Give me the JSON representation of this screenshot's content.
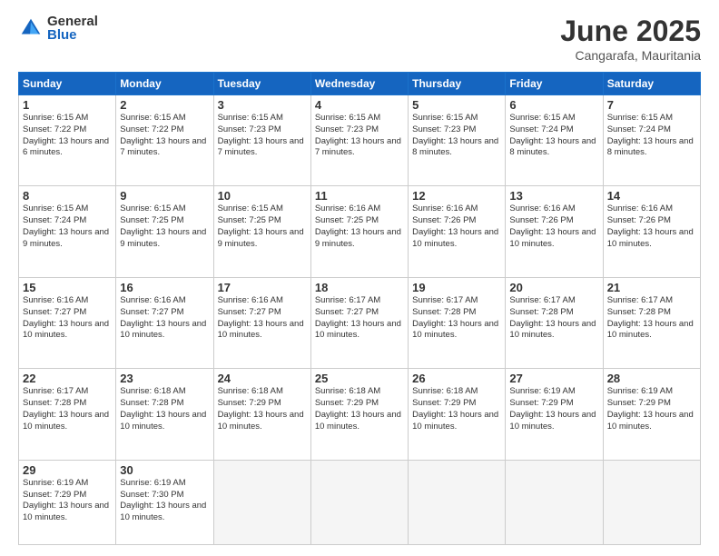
{
  "logo": {
    "general": "General",
    "blue": "Blue"
  },
  "title": "June 2025",
  "location": "Cangarafa, Mauritania",
  "weekdays": [
    "Sunday",
    "Monday",
    "Tuesday",
    "Wednesday",
    "Thursday",
    "Friday",
    "Saturday"
  ],
  "weeks": [
    [
      {
        "day": "1",
        "sunrise": "6:15 AM",
        "sunset": "7:22 PM",
        "daylight": "13 hours and 6 minutes."
      },
      {
        "day": "2",
        "sunrise": "6:15 AM",
        "sunset": "7:22 PM",
        "daylight": "13 hours and 7 minutes."
      },
      {
        "day": "3",
        "sunrise": "6:15 AM",
        "sunset": "7:23 PM",
        "daylight": "13 hours and 7 minutes."
      },
      {
        "day": "4",
        "sunrise": "6:15 AM",
        "sunset": "7:23 PM",
        "daylight": "13 hours and 7 minutes."
      },
      {
        "day": "5",
        "sunrise": "6:15 AM",
        "sunset": "7:23 PM",
        "daylight": "13 hours and 8 minutes."
      },
      {
        "day": "6",
        "sunrise": "6:15 AM",
        "sunset": "7:24 PM",
        "daylight": "13 hours and 8 minutes."
      },
      {
        "day": "7",
        "sunrise": "6:15 AM",
        "sunset": "7:24 PM",
        "daylight": "13 hours and 8 minutes."
      }
    ],
    [
      {
        "day": "8",
        "sunrise": "6:15 AM",
        "sunset": "7:24 PM",
        "daylight": "13 hours and 9 minutes."
      },
      {
        "day": "9",
        "sunrise": "6:15 AM",
        "sunset": "7:25 PM",
        "daylight": "13 hours and 9 minutes."
      },
      {
        "day": "10",
        "sunrise": "6:15 AM",
        "sunset": "7:25 PM",
        "daylight": "13 hours and 9 minutes."
      },
      {
        "day": "11",
        "sunrise": "6:16 AM",
        "sunset": "7:25 PM",
        "daylight": "13 hours and 9 minutes."
      },
      {
        "day": "12",
        "sunrise": "6:16 AM",
        "sunset": "7:26 PM",
        "daylight": "13 hours and 10 minutes."
      },
      {
        "day": "13",
        "sunrise": "6:16 AM",
        "sunset": "7:26 PM",
        "daylight": "13 hours and 10 minutes."
      },
      {
        "day": "14",
        "sunrise": "6:16 AM",
        "sunset": "7:26 PM",
        "daylight": "13 hours and 10 minutes."
      }
    ],
    [
      {
        "day": "15",
        "sunrise": "6:16 AM",
        "sunset": "7:27 PM",
        "daylight": "13 hours and 10 minutes."
      },
      {
        "day": "16",
        "sunrise": "6:16 AM",
        "sunset": "7:27 PM",
        "daylight": "13 hours and 10 minutes."
      },
      {
        "day": "17",
        "sunrise": "6:16 AM",
        "sunset": "7:27 PM",
        "daylight": "13 hours and 10 minutes."
      },
      {
        "day": "18",
        "sunrise": "6:17 AM",
        "sunset": "7:27 PM",
        "daylight": "13 hours and 10 minutes."
      },
      {
        "day": "19",
        "sunrise": "6:17 AM",
        "sunset": "7:28 PM",
        "daylight": "13 hours and 10 minutes."
      },
      {
        "day": "20",
        "sunrise": "6:17 AM",
        "sunset": "7:28 PM",
        "daylight": "13 hours and 10 minutes."
      },
      {
        "day": "21",
        "sunrise": "6:17 AM",
        "sunset": "7:28 PM",
        "daylight": "13 hours and 10 minutes."
      }
    ],
    [
      {
        "day": "22",
        "sunrise": "6:17 AM",
        "sunset": "7:28 PM",
        "daylight": "13 hours and 10 minutes."
      },
      {
        "day": "23",
        "sunrise": "6:18 AM",
        "sunset": "7:28 PM",
        "daylight": "13 hours and 10 minutes."
      },
      {
        "day": "24",
        "sunrise": "6:18 AM",
        "sunset": "7:29 PM",
        "daylight": "13 hours and 10 minutes."
      },
      {
        "day": "25",
        "sunrise": "6:18 AM",
        "sunset": "7:29 PM",
        "daylight": "13 hours and 10 minutes."
      },
      {
        "day": "26",
        "sunrise": "6:18 AM",
        "sunset": "7:29 PM",
        "daylight": "13 hours and 10 minutes."
      },
      {
        "day": "27",
        "sunrise": "6:19 AM",
        "sunset": "7:29 PM",
        "daylight": "13 hours and 10 minutes."
      },
      {
        "day": "28",
        "sunrise": "6:19 AM",
        "sunset": "7:29 PM",
        "daylight": "13 hours and 10 minutes."
      }
    ],
    [
      {
        "day": "29",
        "sunrise": "6:19 AM",
        "sunset": "7:29 PM",
        "daylight": "13 hours and 10 minutes."
      },
      {
        "day": "30",
        "sunrise": "6:19 AM",
        "sunset": "7:30 PM",
        "daylight": "13 hours and 10 minutes."
      },
      null,
      null,
      null,
      null,
      null
    ]
  ]
}
